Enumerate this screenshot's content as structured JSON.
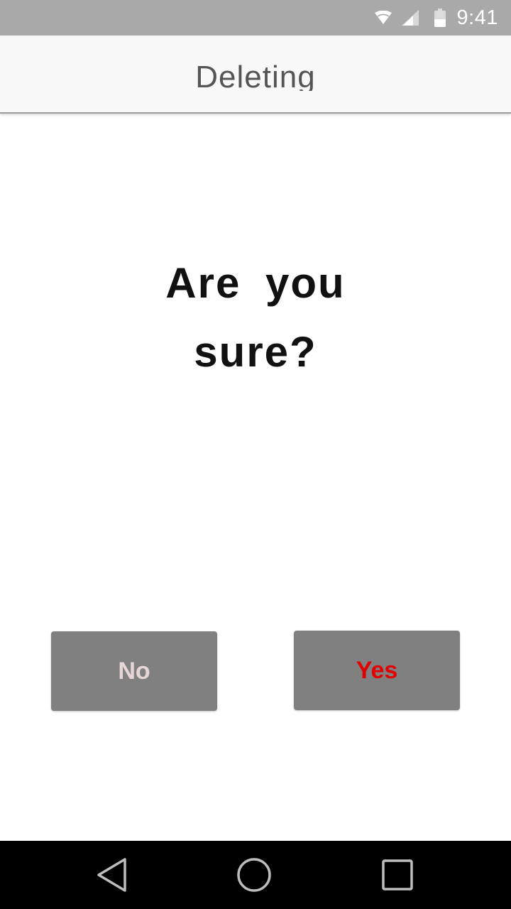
{
  "status_bar": {
    "time": "9:41",
    "icons": [
      "wifi-icon",
      "signal-icon",
      "battery-icon"
    ]
  },
  "app_bar": {
    "title": "Deleting"
  },
  "dialog": {
    "question_line1": "Are you",
    "question_line2": "sure?"
  },
  "buttons": {
    "no_label": "No",
    "yes_label": "Yes"
  },
  "nav_bar": {
    "icons": [
      "back-icon",
      "home-icon",
      "recents-icon"
    ]
  },
  "colors": {
    "status_bar_bg": "#a9a9a9",
    "app_bar_bg": "#f8f8f8",
    "button_bg": "#808080",
    "no_text": "#e8d6d6",
    "yes_text": "#e00000",
    "nav_bar_bg": "#000000"
  }
}
